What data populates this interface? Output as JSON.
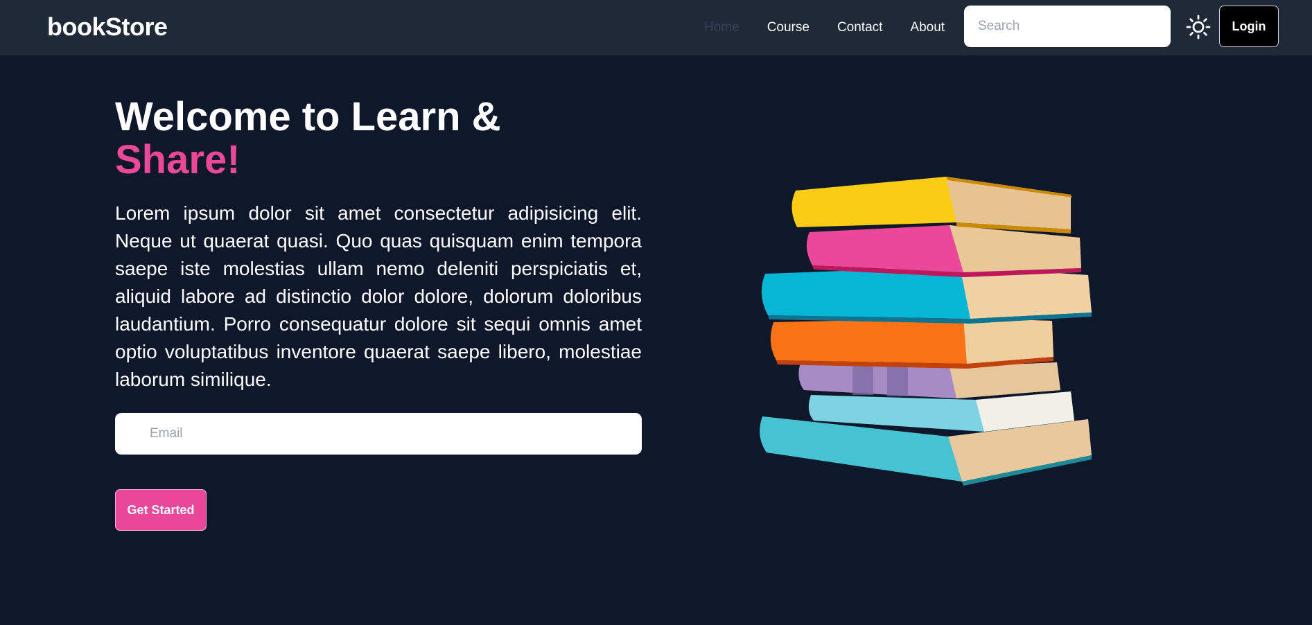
{
  "brand": {
    "name": "bookStore"
  },
  "nav": {
    "items": [
      {
        "label": "Home",
        "active": true
      },
      {
        "label": "Course",
        "active": false
      },
      {
        "label": "Contact",
        "active": false
      },
      {
        "label": "About",
        "active": false
      }
    ],
    "search_placeholder": "Search",
    "theme_icon": "sun-icon",
    "login_label": "Login"
  },
  "hero": {
    "title_line1": "Welcome to Learn &",
    "title_line2": "Share!",
    "description": "Lorem ipsum dolor sit amet consectetur adipisicing elit. Neque ut quaerat quasi. Quo quas quisquam enim tempora saepe iste molestias ullam nemo deleniti perspiciatis et, aliquid labore ad distinctio dolor dolore, dolorum doloribus laudantium. Porro consequatur dolore sit sequi omnis amet optio voluptatibus inventore quaerat saepe libero, molestiae laborum similique.",
    "email_placeholder": "Email",
    "cta_label": "Get Started"
  },
  "colors": {
    "background": "#0f172a",
    "navbar": "#1f2937",
    "accent": "#ec4899"
  }
}
